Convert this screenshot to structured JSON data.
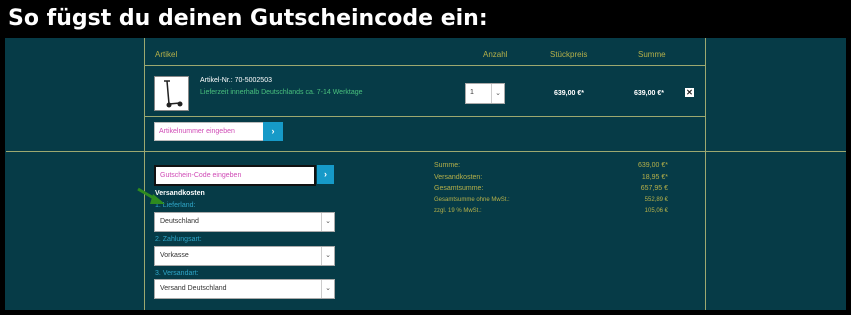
{
  "headline": "So fügst du deinen Gutscheincode ein:",
  "cart": {
    "headers": {
      "article": "Artikel",
      "qty": "Anzahl",
      "unit_price": "Stückpreis",
      "total": "Summe"
    },
    "item": {
      "article_number": "Artikel-Nr.: 70-5002503",
      "delivery": "Lieferzeit innerhalb Deutschlands ca. 7-14 Werktage",
      "quantity": "1",
      "unit_price": "639,00 €*",
      "total": "639,00 €*",
      "remove_symbol": "✕"
    },
    "article_input_placeholder": "Artikelnummer eingeben",
    "go_symbol": "›"
  },
  "voucher": {
    "placeholder": "Gutschein-Code eingeben",
    "go_symbol": "›"
  },
  "shipping": {
    "title": "Versandkosten",
    "steps": [
      {
        "label": "1. Lieferland:",
        "value": "Deutschland"
      },
      {
        "label": "2. Zahlungsart:",
        "value": "Vorkasse"
      },
      {
        "label": "3. Versandart:",
        "value": "Versand Deutschland"
      }
    ],
    "caret": "⌄"
  },
  "summary": {
    "rows": [
      {
        "label": "Summe:",
        "value": "639,00 €*"
      },
      {
        "label": "Versandkosten:",
        "value": "18,95 €*"
      },
      {
        "label": "Gesamtsumme:",
        "value": "657,95 €"
      },
      {
        "label": "Gesamtsumme ohne MwSt.:",
        "value": "552,89 €"
      },
      {
        "label": "zzgl. 19 % MwSt.:",
        "value": "105,06 €"
      }
    ]
  },
  "colors": {
    "panel_bg": "#063b47",
    "accent_olive": "#b5b04a",
    "link_green": "#49c07d",
    "button_blue": "#169ac8",
    "placeholder_pink": "#d04bb6"
  }
}
